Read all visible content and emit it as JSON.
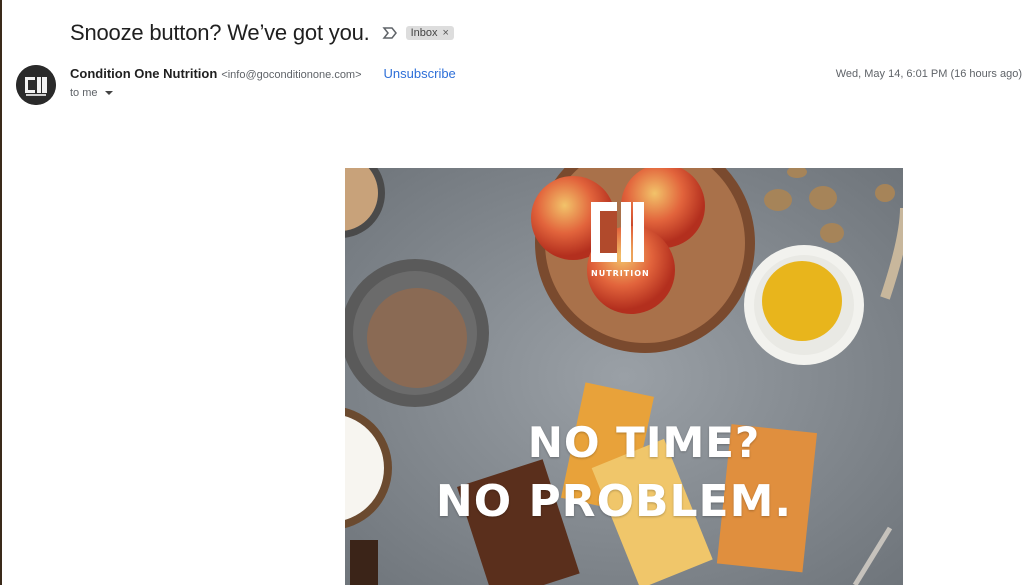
{
  "email": {
    "subject": "Snooze button? We’ve got you.",
    "label": "Inbox",
    "label_close": "×",
    "sender_name": "Condition One Nutrition",
    "sender_email": "<info@goconditionone.com>",
    "unsubscribe": "Unsubscribe",
    "recipient": "to me",
    "date": "Wed, May 14, 6:01 PM (16 hours ago)"
  },
  "hero": {
    "brand_word": "NUTRITION",
    "headline_line1": "NO TIME?",
    "headline_line2": "NO PROBLEM."
  },
  "icons": {
    "important": "important-marker-icon",
    "avatar": "c1-logo-icon",
    "expand": "caret-down-icon"
  },
  "colors": {
    "link": "#2e6fd8",
    "chip_bg": "#dddddd",
    "hero_bg": "#8f959b"
  }
}
